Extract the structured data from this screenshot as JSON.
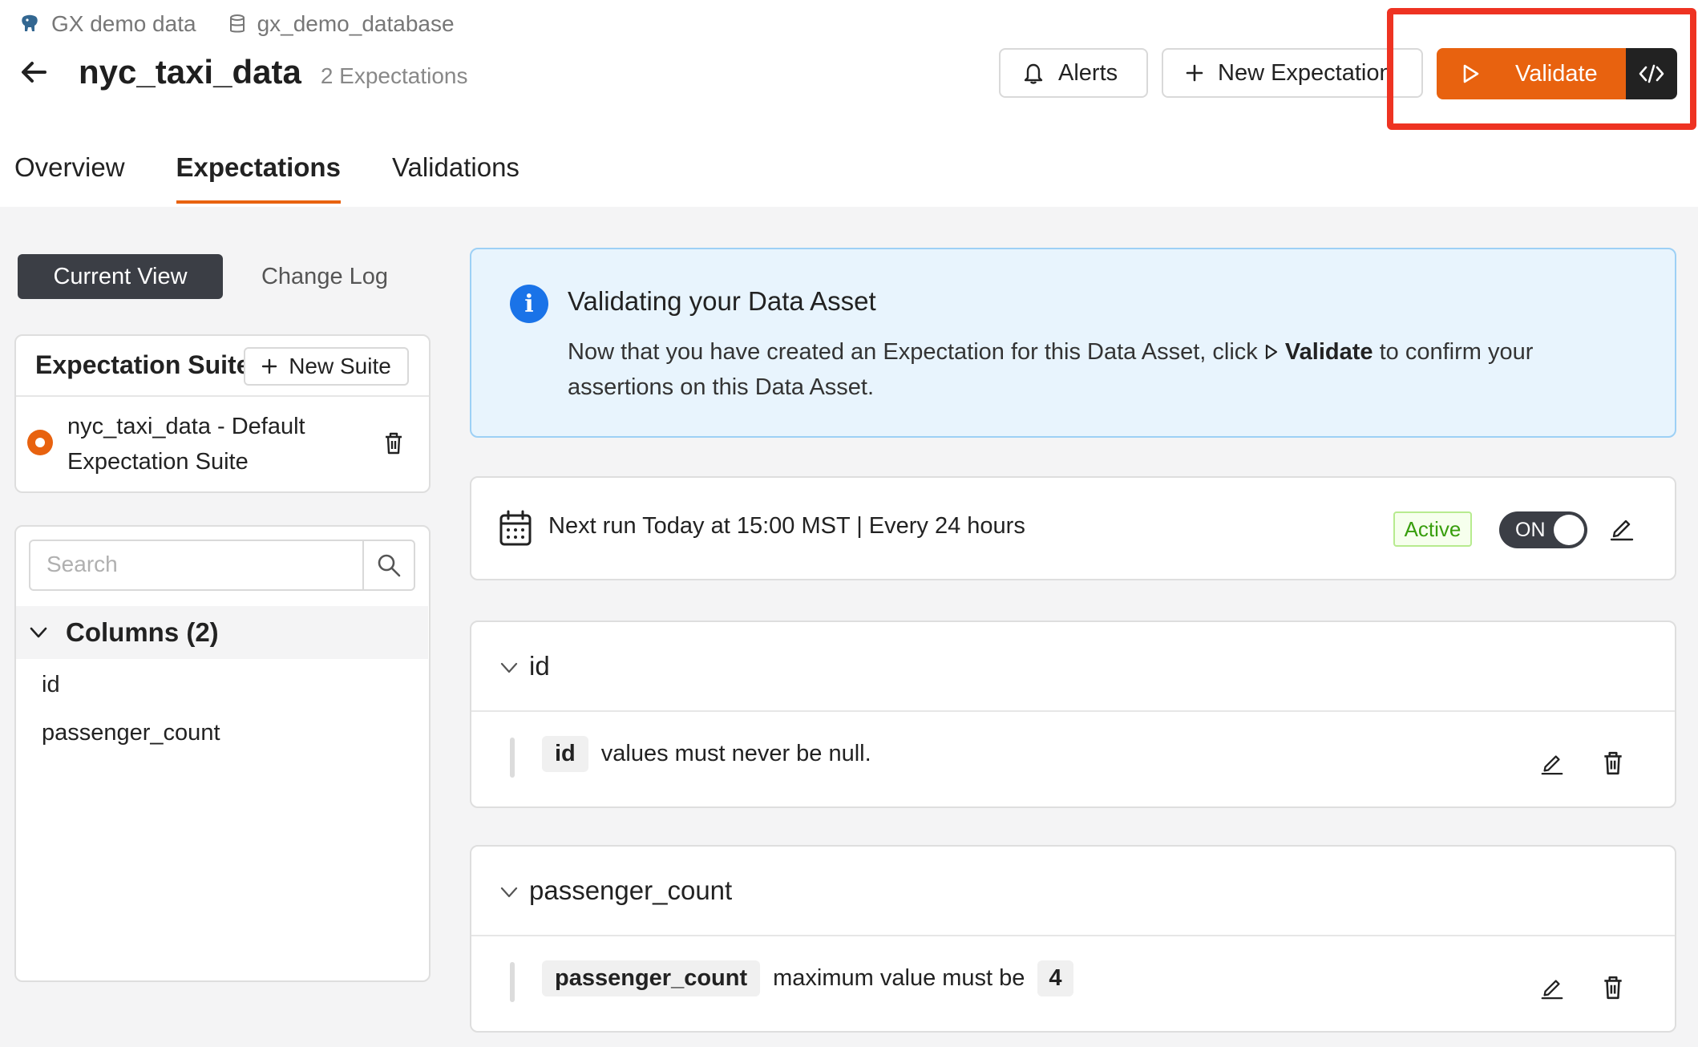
{
  "breadcrumb": {
    "datasource": "GX demo data",
    "database": "gx_demo_database"
  },
  "header": {
    "title": "nyc_taxi_data",
    "subtitle": "2 Expectations"
  },
  "actions": {
    "alerts_label": "Alerts",
    "new_expectation_label": "New Expectation",
    "validate_label": "Validate"
  },
  "tabs": [
    {
      "label": "Overview",
      "active": false
    },
    {
      "label": "Expectations",
      "active": true
    },
    {
      "label": "Validations",
      "active": false
    }
  ],
  "view_toggle": {
    "current": "Current View",
    "changelog": "Change Log"
  },
  "suites": {
    "title": "Expectation Suites",
    "new_label": "New Suite",
    "items": [
      {
        "name": "nyc_taxi_data - Default Expectation Suite",
        "selected": true
      }
    ]
  },
  "search": {
    "placeholder": "Search",
    "value": ""
  },
  "columns": {
    "title": "Columns (2)",
    "items": [
      "id",
      "passenger_count"
    ]
  },
  "info": {
    "title": "Validating your Data Asset",
    "text_before": "Now that you have created an Expectation for this Data Asset, click ",
    "text_bold": "Validate",
    "text_after": " to confirm your assertions on this Data Asset."
  },
  "schedule": {
    "text": "Next run Today at 15:00 MST | Every 24 hours",
    "badge": "Active",
    "toggle_label": "ON",
    "toggle_on": true
  },
  "expectation_groups": [
    {
      "column": "id",
      "expectation": {
        "column_chip": "id",
        "text": "values must never be null.",
        "value": ""
      }
    },
    {
      "column": "passenger_count",
      "expectation": {
        "column_chip": "passenger_count",
        "text": "maximum value must be",
        "value": "4"
      }
    }
  ],
  "colors": {
    "accent": "#e8620f",
    "info_blue": "#1a73e8",
    "active_green": "#389e0d",
    "highlight_red": "#ee3322"
  }
}
